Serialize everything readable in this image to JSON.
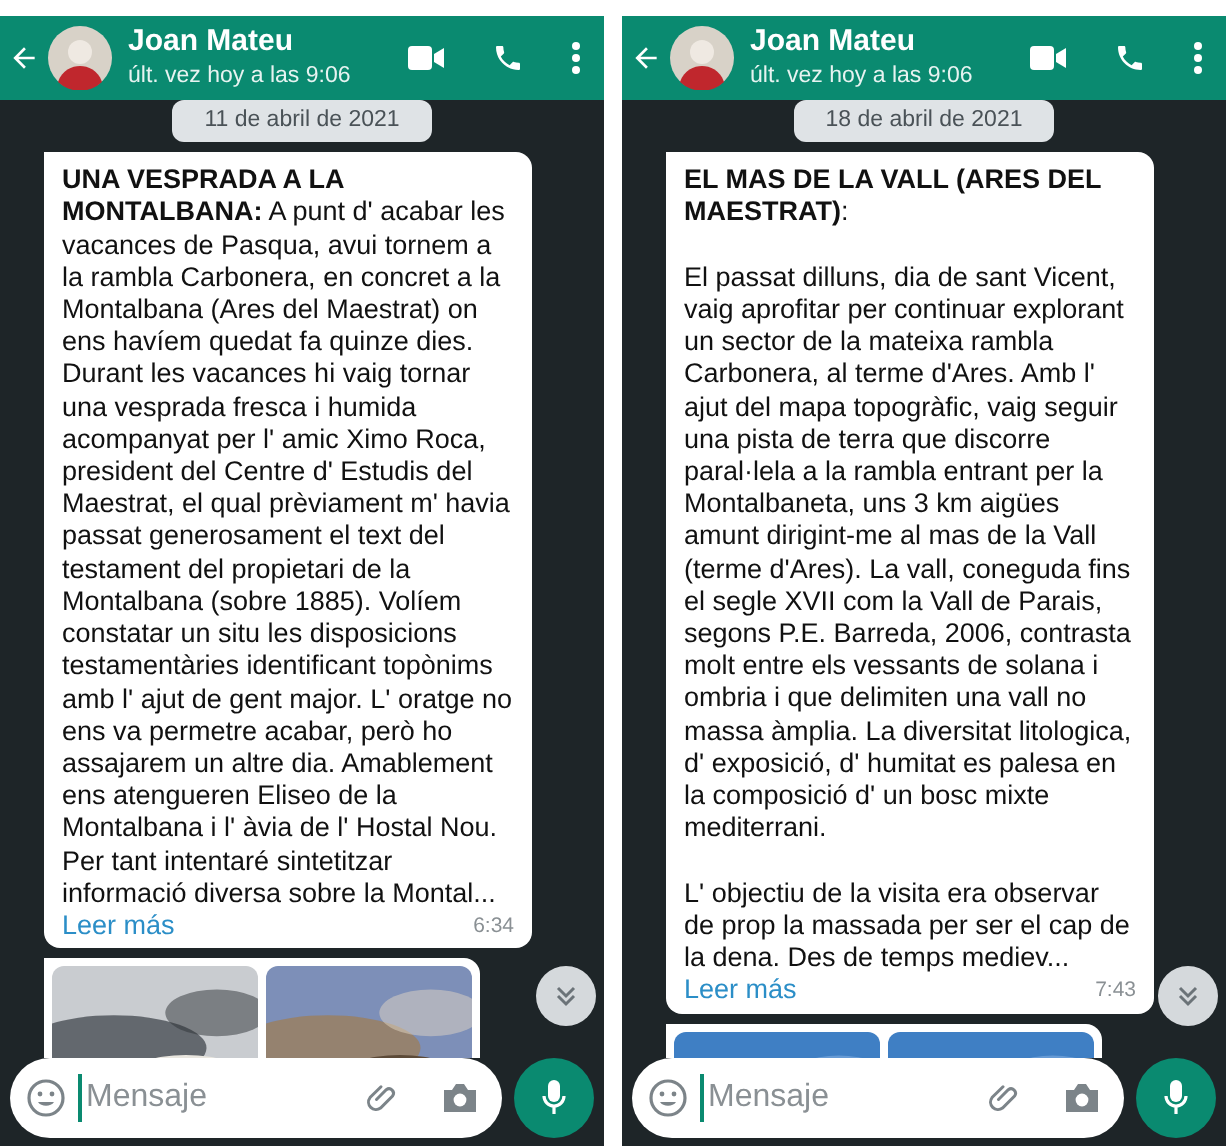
{
  "panels": [
    {
      "header": {
        "name": "Joan Mateu",
        "status": "últ. vez hoy a las 9:06"
      },
      "date_chip": "11 de abril de 2021",
      "message": {
        "paragraphs": [
          "**UNA VESPRADA A LA MONTALBANA:** A punt d' acabar les vacances de Pasqua, avui tornem a la rambla Carbonera, en concret a la Montalbana (Ares del Maestrat) on ens havíem quedat fa quinze dies. Durant les vacances hi vaig tornar una vesprada fresca i humida acompanyat per l' amic Ximo Roca, president del Centre d' Estudis del Maestrat, el qual prèviament m' havia passat generosament el text del testament del propietari de la Montalbana (sobre 1885). Volíem constatar un situ les disposicions testamentàries identificant topònims amb l' ajut de gent major. L' oratge no ens va permetre acabar, però ho assajarem un altre dia. Amablement ens atengueren Eliseo de la Montalbana i l' àvia de l' Hostal Nou. Per tant intentaré sintetitzar informació diversa sobre la Montal..."
        ],
        "read_more": "Leer más",
        "time": "6:34"
      },
      "composer": {
        "placeholder": "Mensaje"
      }
    },
    {
      "header": {
        "name": "Joan Mateu",
        "status": "últ. vez hoy a las 9:06"
      },
      "date_chip": "18 de abril de 2021",
      "message": {
        "paragraphs": [
          "**EL MAS DE LA VALL (ARES DEL MAESTRAT)**:",
          "El passat dilluns, dia de sant Vicent, vaig aprofitar per continuar explorant un sector de la mateixa rambla Carbonera, al terme d'Ares. Amb l' ajut del mapa topogràfic, vaig seguir una pista de terra que discorre paral·lela a la rambla entrant per la Montalbaneta, uns 3 km aigües amunt dirigint-me al mas de la Vall (terme d'Ares). La vall, coneguda fins el segle XVII com la Vall de Parais, segons P.E. Barreda, 2006, contrasta molt entre els vessants de solana i ombria i que delimiten una vall no massa àmplia. La diversitat litologica, d' exposició, d' humitat es palesa en la composició d' un bosc mixte mediterrani.",
          "L' objectiu de la visita era observar de prop la massada per ser el cap de la dena. Des de temps mediev..."
        ],
        "read_more": "Leer más",
        "time": "7:43"
      },
      "composer": {
        "placeholder": "Mensaje"
      }
    }
  ]
}
